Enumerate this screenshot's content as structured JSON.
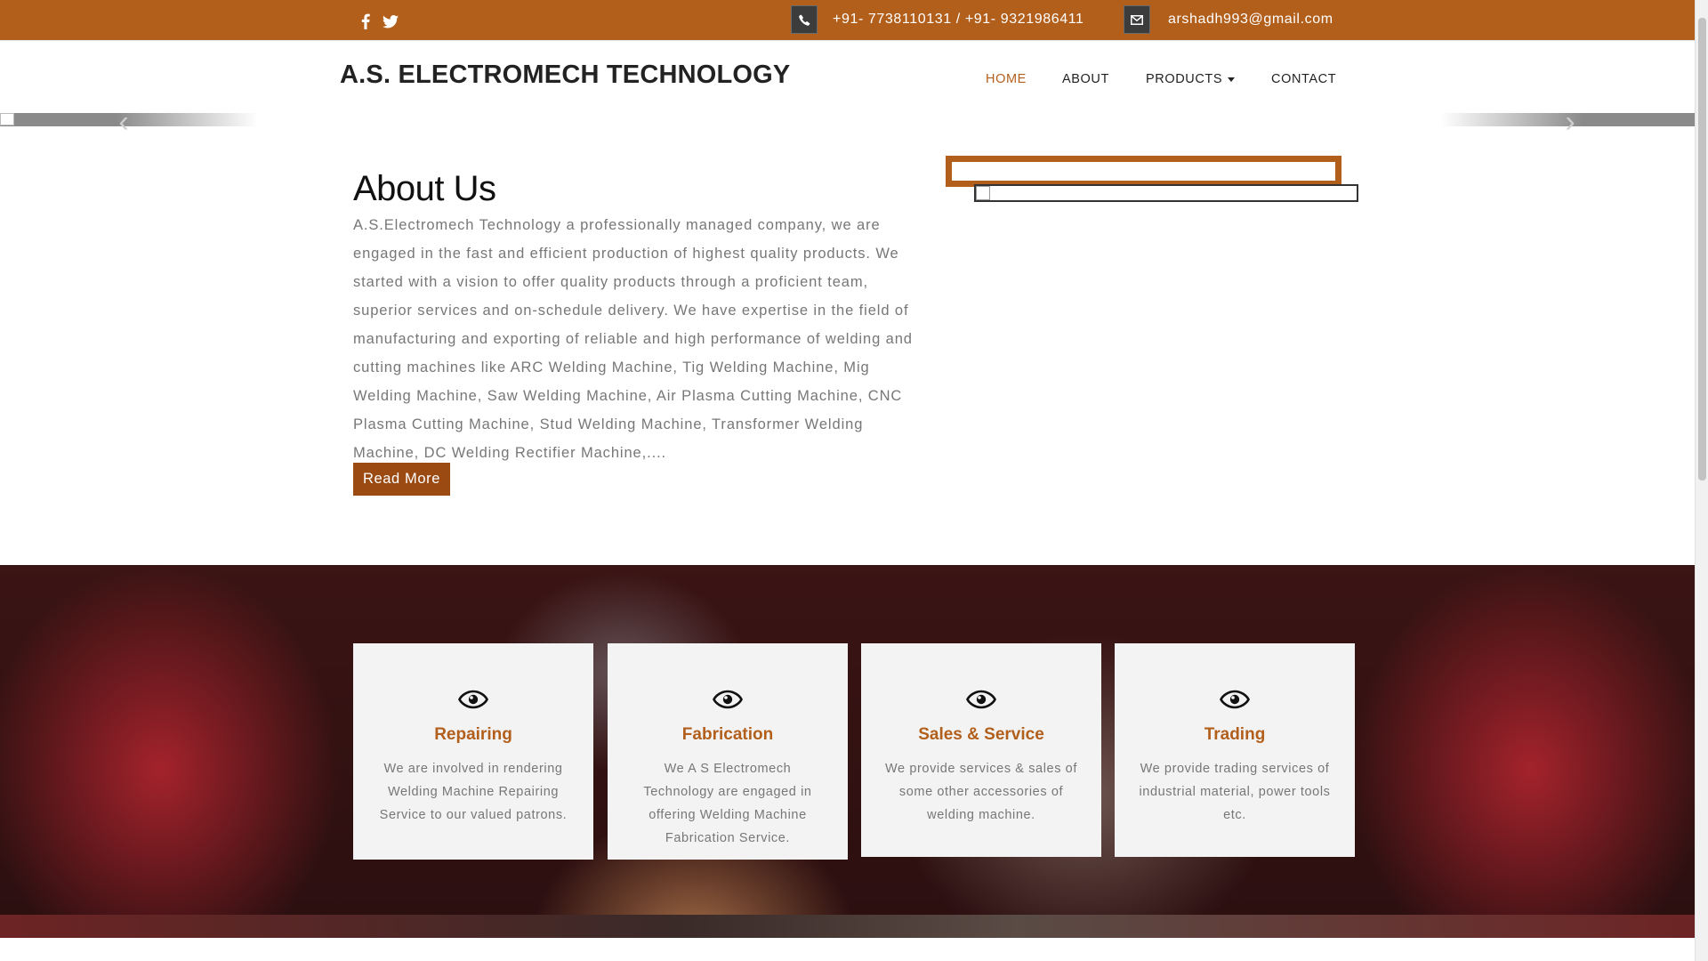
{
  "topbar": {
    "phone_icon": "phone-icon",
    "phone": "+91- 7738110131 / +91- 9321986411",
    "email_icon": "envelope-icon",
    "email": "arshadh993@gmail.com",
    "social": [
      "facebook-icon",
      "twitter-icon"
    ]
  },
  "header": {
    "brand": "A.S. ELECTROMECH TECHNOLOGY",
    "nav": [
      {
        "label": "HOME",
        "active": true
      },
      {
        "label": "ABOUT",
        "active": false
      },
      {
        "label": "PRODUCTS",
        "active": false
      },
      {
        "label": "CONTACT",
        "active": false
      }
    ]
  },
  "about": {
    "title": "About Us",
    "text": "A.S.Electromech Technology a professionally managed company, we are engaged in the fast and efficient production of highest quality products. We started with a vision to offer quality products through a proficient team, superior services and on-schedule delivery. We have expertise in the field of manufacturing and exporting of reliable and high performance of welding and cutting machines like ARC Welding Machine, Tig Welding Machine, Mig Welding Machine, Saw Welding Machine, Air Plasma Cutting Machine, CNC Plasma Cutting Machine, Stud Welding Machine, Transformer Welding Machine, DC Welding Rectifier Machine,....",
    "read_more": "Read More"
  },
  "services": [
    {
      "icon": "eye-icon",
      "title": "Repairing",
      "text": "We are involved in rendering Welding Machine Repairing Service to our valued patrons."
    },
    {
      "icon": "eye-icon",
      "title": "Fabrication",
      "text": "We A S Electromech Technology are engaged in offering Welding Machine Fabrication Service."
    },
    {
      "icon": "eye-icon",
      "title": "Sales & Service",
      "text": "We provide services & sales of some other accessories of welding machine."
    },
    {
      "icon": "eye-icon",
      "title": "Trading",
      "text": "We provide trading services of industrial material, power tools etc."
    }
  ],
  "colors": {
    "accent": "#b25f1c",
    "button": "#9b4a12",
    "text_muted": "#777777"
  }
}
